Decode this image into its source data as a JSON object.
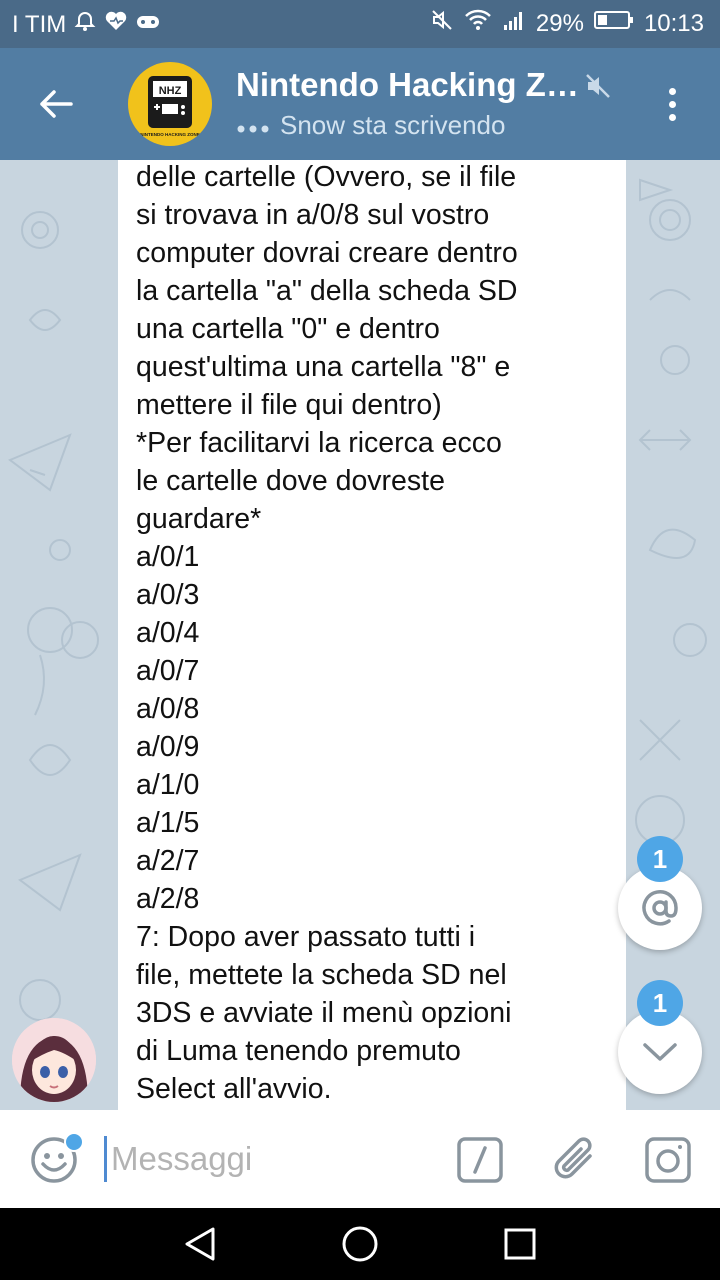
{
  "status_bar": {
    "carrier": "I TIM",
    "battery": "29%",
    "time": "10:13"
  },
  "header": {
    "title": "Nintendo Hacking Z…",
    "avatar_text": "NHZ",
    "avatar_caption": "NINTENDO HACKING ZONE",
    "typing_status": "Snow sta scrivendo"
  },
  "message": {
    "text": "seguendo la stessa struttura\ndelle cartelle (Ovvero, se il file\nsi trovava in a/0/8 sul vostro\ncomputer dovrai creare dentro\nla cartella \"a\" della scheda SD\nuna cartella \"0\" e dentro\nquest'ultima una cartella \"8\" e\nmettere il file qui dentro)\n*Per facilitarvi la ricerca ecco\nle cartelle dove dovreste\nguardare*\na/0/1\na/0/3\na/0/4\na/0/7\na/0/8\na/0/9\na/1/0\na/1/5\na/2/7\na/2/8\n7: Dopo aver passato tutti i\nfile, mettete la scheda SD nel\n3DS e avviate il menù opzioni\ndi Luma tenendo premuto\nSelect all'avvio."
  },
  "badges": {
    "mentions_count": "1",
    "unread_count": "1"
  },
  "input": {
    "placeholder": "Messaggi"
  },
  "colors": {
    "status_bar": "#4a6a88",
    "app_bar": "#527da3",
    "accent": "#4fa6e6",
    "chat_bg": "#c8d5df"
  },
  "icons": {
    "back": "arrow-left-icon",
    "mute": "muted-speaker-icon",
    "more": "vertical-dots-icon",
    "mention": "at-sign-icon",
    "scroll": "chevron-down-icon",
    "emoji": "smiley-icon",
    "command": "slash-command-icon",
    "attach": "paperclip-icon",
    "camera": "camera-icon"
  }
}
